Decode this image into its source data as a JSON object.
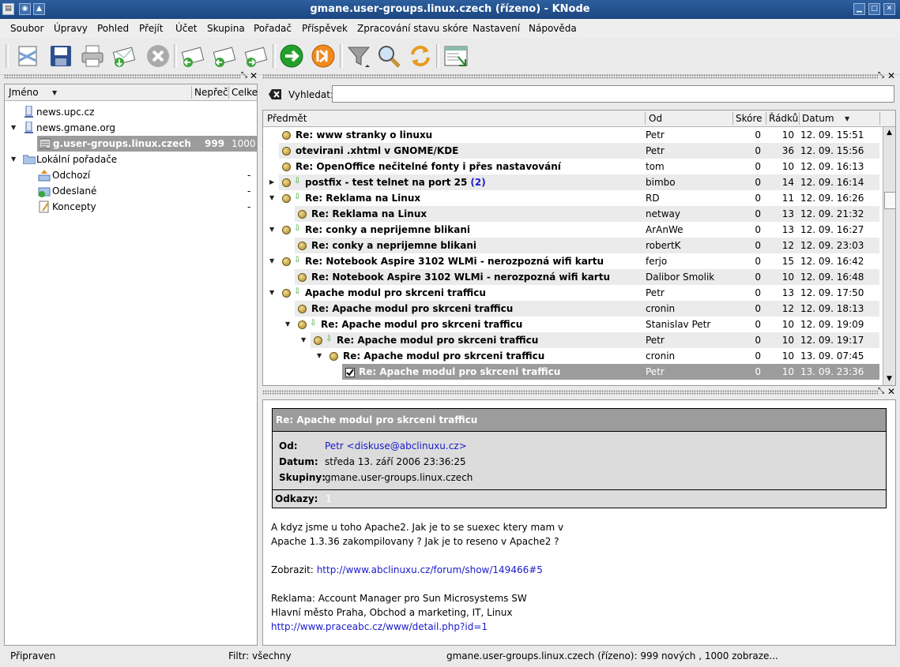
{
  "window": {
    "title": "gmane.user-groups.linux.czech (řízeno) - KNode"
  },
  "menu": [
    "Soubor",
    "Úpravy",
    "Pohled",
    "Přejít",
    "Účet",
    "Skupina",
    "Pořadač",
    "Příspěvek",
    "Zpracování stavu skóre",
    "Nastavení",
    "Nápověda"
  ],
  "toolbar": [
    "new-message-icon",
    "save-icon",
    "print-icon",
    "send-pending-icon",
    "cancel-icon",
    "reply-icon",
    "forward-icon",
    "next-message-icon",
    "go-next-icon",
    "go-next-unread-icon",
    "filter-icon",
    "search-icon",
    "refresh-icon",
    "view-icon"
  ],
  "folders": {
    "headers": {
      "name": "Jméno",
      "unread": "Nepřeč",
      "total": "Celke"
    },
    "items": [
      {
        "label": "news.upc.cz",
        "icon": "server-icon"
      },
      {
        "label": "news.gmane.org",
        "icon": "server-icon"
      },
      {
        "label": "g.user-groups.linux.czech",
        "unread": "999",
        "total": "1000",
        "selected": true
      },
      {
        "label": "Lokální pořadače",
        "icon": "folder-icon"
      },
      {
        "label": "Odchozí",
        "unread": "-",
        "icon": "outbox-icon"
      },
      {
        "label": "Odeslané",
        "unread": "-",
        "icon": "sent-icon"
      },
      {
        "label": "Koncepty",
        "unread": "-",
        "icon": "drafts-icon"
      }
    ]
  },
  "search": {
    "label": "Vyhledat:",
    "value": ""
  },
  "articles": {
    "headers": {
      "subject": "Předmět",
      "from": "Od",
      "score": "Skóre",
      "lines": "Řádků",
      "date": "Datum"
    },
    "rows": [
      {
        "subject": "Re: www stranky o linuxu",
        "from": "Petr",
        "score": "0",
        "lines": "10",
        "date": "12. 09. 15:51"
      },
      {
        "subject": "otevirani .xhtml v GNOME/KDE",
        "from": "Petr",
        "score": "0",
        "lines": "36",
        "date": "12. 09. 15:56"
      },
      {
        "subject": "Re: OpenOffice nečitelné fonty i přes nastavování",
        "from": "tom",
        "score": "0",
        "lines": "10",
        "date": "12. 09. 16:13"
      },
      {
        "subject": "postfix - test telnet na port 25",
        "count": "(2)",
        "from": "bimbo",
        "score": "0",
        "lines": "14",
        "date": "12. 09. 16:14"
      },
      {
        "subject": "Re: Reklama na Linux",
        "from": "RD",
        "score": "0",
        "lines": "11",
        "date": "12. 09. 16:26"
      },
      {
        "subject": "Re: Reklama na Linux",
        "from": "netway",
        "score": "0",
        "lines": "13",
        "date": "12. 09. 21:32"
      },
      {
        "subject": "Re: conky a neprijemne blikani",
        "from": "ArAnWe",
        "score": "0",
        "lines": "13",
        "date": "12. 09. 16:27"
      },
      {
        "subject": "Re: conky a neprijemne blikani",
        "from": "robertK",
        "score": "0",
        "lines": "12",
        "date": "12. 09. 23:03"
      },
      {
        "subject": "Re: Notebook Aspire 3102 WLMi - nerozpozná wifi kartu",
        "from": "ferjo",
        "score": "0",
        "lines": "15",
        "date": "12. 09. 16:42"
      },
      {
        "subject": "Re: Notebook Aspire 3102 WLMi - nerozpozná wifi kartu",
        "from": "Dalibor Smolik",
        "score": "0",
        "lines": "10",
        "date": "12. 09. 16:48"
      },
      {
        "subject": "Apache modul pro skrceni trafficu",
        "from": "Petr",
        "score": "0",
        "lines": "13",
        "date": "12. 09. 17:50"
      },
      {
        "subject": "Re: Apache modul pro skrceni trafficu",
        "from": "cronin",
        "score": "0",
        "lines": "12",
        "date": "12. 09. 18:13"
      },
      {
        "subject": "Re: Apache modul pro skrceni trafficu",
        "from": "Stanislav Petr",
        "score": "0",
        "lines": "10",
        "date": "12. 09. 19:09"
      },
      {
        "subject": "Re: Apache modul pro skrceni trafficu",
        "from": "Petr",
        "score": "0",
        "lines": "10",
        "date": "12. 09. 19:17"
      },
      {
        "subject": "Re: Apache modul pro skrceni trafficu",
        "from": "cronin",
        "score": "0",
        "lines": "10",
        "date": "13. 09. 07:45"
      },
      {
        "subject": "Re: Apache modul pro skrceni trafficu",
        "from": "Petr",
        "score": "0",
        "lines": "10",
        "date": "13. 09. 23:36",
        "selected": true
      }
    ]
  },
  "message": {
    "subject": "Re: Apache modul pro skrceni trafficu",
    "from_label": "Od:",
    "from": "Petr <diskuse@abclinuxu.cz>",
    "date_label": "Datum:",
    "date": "středa 13. září 2006 23:36:25",
    "groups_label": "Skupiny:",
    "groups": "gmane.user-groups.linux.czech",
    "refs_label": "Odkazy:",
    "refs": "1",
    "body": [
      "A kdyz jsme u toho Apache2. Jak je to se suexec ktery mam v",
      "Apache 1.3.36 zakompilovany ? Jak je to reseno v Apache2 ?",
      "",
      "Zobrazit:",
      "",
      "Reklama: Account Manager pro Sun Microsystems SW",
      "Hlavní město Praha, Obchod a marketing, IT, Linux"
    ],
    "link1": "http://www.abclinuxu.cz/forum/show/149466#5",
    "link2": "http://www.praceabc.cz/www/detail.php?id=1"
  },
  "status": {
    "left": "Připraven",
    "filter": "Filtr: všechny",
    "right": "gmane.user-groups.linux.czech (řízeno): 999 nových , 1000 zobraze..."
  }
}
